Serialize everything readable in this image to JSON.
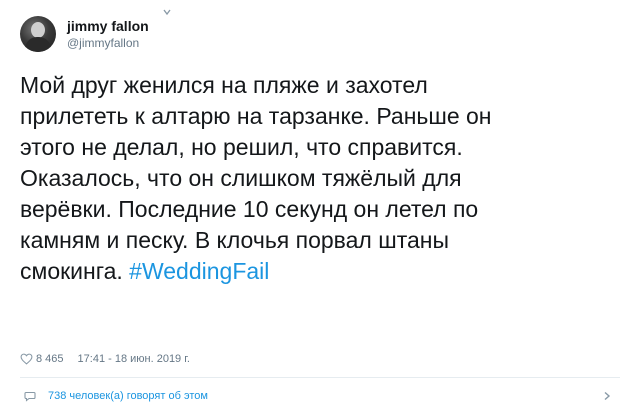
{
  "author": {
    "display_name": "jimmy fallon",
    "handle": "@jimmyfallon",
    "avatar_icon": "avatar-photo"
  },
  "tweet": {
    "lines": [
      "Мой друг женился на пляже и захотел",
      "прилететь к алтарю на тарзанке. Раньше он",
      "этого не делал, но решил, что справится.",
      "Оказалось, что он слишком тяжёлый для",
      "верёвки. Последние 10 секунд он летел по",
      "камням и песку. В клочья порвал штаны"
    ],
    "last_line_text": "смокинга.",
    "hashtag": "#WeddingFail"
  },
  "meta": {
    "likes": "8 465",
    "timestamp": "17:41 - 18 июн. 2019 г."
  },
  "footer": {
    "talking_text": "738 человек(а) говорят об этом"
  },
  "colors": {
    "text": "#14171a",
    "secondary": "#657786",
    "link": "#1b95e0",
    "divider": "#e6ecf0"
  }
}
